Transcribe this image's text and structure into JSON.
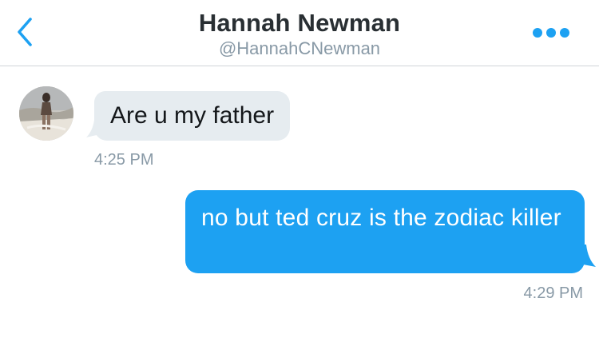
{
  "header": {
    "name": "Hannah Newman",
    "handle": "@HannahCNewman",
    "back_icon": "chevron-left-icon",
    "more_icon": "ellipsis-icon"
  },
  "colors": {
    "accent": "#1da1f2",
    "incoming_bubble": "#e6ecf0",
    "secondary_text": "#8899a6",
    "primary_text": "#292f33"
  },
  "messages": [
    {
      "direction": "incoming",
      "text": "Are u my father",
      "time": "4:25 PM"
    },
    {
      "direction": "outgoing",
      "text": "no but ted cruz is the zodiac killer",
      "time": "4:29 PM"
    }
  ]
}
